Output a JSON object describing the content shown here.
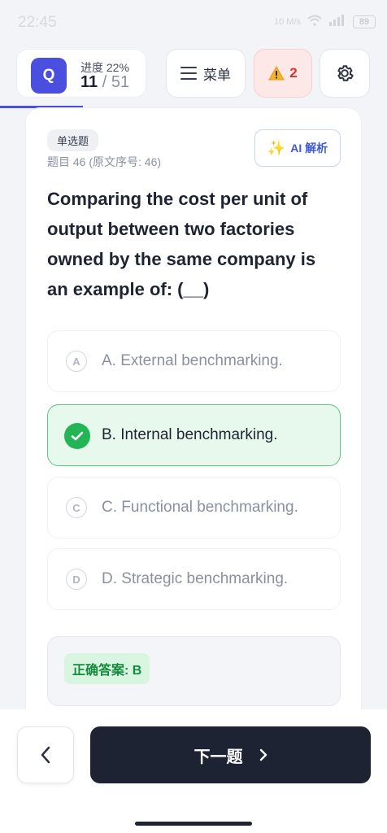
{
  "status_bar": {
    "time": "22:45",
    "network": "10 M/s",
    "battery": "89"
  },
  "toolbar": {
    "badge": "Q",
    "progress_label": "进度 22%",
    "progress_value": 0.22,
    "current": "11",
    "total": " / 51",
    "menu_label": "菜单",
    "warning_count": "2"
  },
  "question": {
    "type_tag": "单选题",
    "meta": "题目 46 (原文序号: 46)",
    "ai_label": "AI 解析",
    "text": "Comparing the cost per unit of output between two factories owned by the same company is an example of: (__)",
    "options": [
      {
        "letter": "A",
        "text": "A. External benchmarking.",
        "state": "default"
      },
      {
        "letter": "B",
        "text": "B. Internal benchmarking.",
        "state": "correct"
      },
      {
        "letter": "C",
        "text": "C. Functional benchmarking.",
        "state": "default"
      },
      {
        "letter": "D",
        "text": "D. Strategic benchmarking.",
        "state": "default"
      }
    ],
    "answer_label": "正确答案: B"
  },
  "bottom_nav": {
    "next_label": "下一题"
  },
  "colors": {
    "accent": "#4a4fe0",
    "correct_bg": "#e7f8ec",
    "correct_border": "#5cc77a",
    "check": "#22b455",
    "warn_bg": "#fde8e8",
    "warn_text": "#d63333",
    "next_bg": "#1d2333"
  },
  "icons": [
    "hamburger-icon",
    "warning-icon",
    "gear-icon",
    "sparkle-icon",
    "check-icon",
    "chevron-left-icon",
    "chevron-right-icon"
  ]
}
